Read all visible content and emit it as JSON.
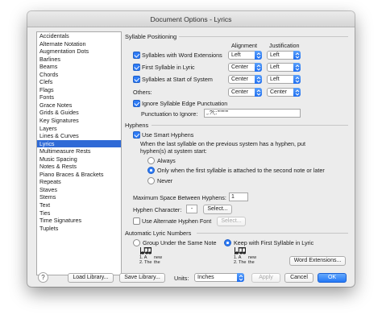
{
  "window": {
    "title": "Document Options - Lyrics"
  },
  "sidebar": {
    "items": [
      "Accidentals",
      "Alternate Notation",
      "Augmentation Dots",
      "Barlines",
      "Beams",
      "Chords",
      "Clefs",
      "Flags",
      "Fonts",
      "Grace Notes",
      "Grids & Guides",
      "Key Signatures",
      "Layers",
      "Lines & Curves",
      "Lyrics",
      "Multimeasure Rests",
      "Music Spacing",
      "Notes & Rests",
      "Piano Braces & Brackets",
      "Repeats",
      "Staves",
      "Stems",
      "Text",
      "Ties",
      "Time Signatures",
      "Tuplets"
    ],
    "selected": "Lyrics"
  },
  "syllable": {
    "heading": "Syllable Positioning",
    "col_alignment": "Alignment",
    "col_justification": "Justification",
    "rows": [
      {
        "label": "Syllables with Word Extensions",
        "checked": true,
        "alignment": "Left",
        "justification": "Left"
      },
      {
        "label": "First Syllable in Lyric",
        "checked": true,
        "alignment": "Center",
        "justification": "Left"
      },
      {
        "label": "Syllables at Start of System",
        "checked": true,
        "alignment": "Center",
        "justification": "Left"
      }
    ],
    "others_label": "Others:",
    "others_alignment": "Center",
    "others_justification": "Center",
    "ignore_label": "Ignore Syllable Edge Punctuation",
    "ignore_checked": true,
    "punct_label": "Punctuation to Ignore:",
    "punct_value": ",.?!;:'\"\"\"\"\""
  },
  "hyphens": {
    "heading": "Hyphens",
    "smart_label": "Use Smart Hyphens",
    "smart_checked": true,
    "desc1": "When the last syllable on the previous system has a hyphen, put",
    "desc2": "hyphen(s) at system start:",
    "opt_always": "Always",
    "opt_only": "Only when the first syllable is attached to the second note or later",
    "opt_never": "Never",
    "selected_option": "only",
    "max_label": "Maximum Space Between Hyphens:",
    "max_value": "1",
    "char_label": "Hyphen Character:",
    "char_value": "-",
    "select_label": "Select...",
    "alt_font_label": "Use Alternate Hyphen Font",
    "alt_font_checked": false,
    "alt_select_label": "Select..."
  },
  "auto_numbers": {
    "heading": "Automatic Lyric Numbers",
    "opt_group": "Group Under the Same Note",
    "opt_keep": "Keep with First Syllable in Lyric",
    "selected": "keep",
    "sample1_line1": "1. A",
    "sample1_line2": "2. The",
    "sample1_w1": "new",
    "sample1_w2": "the",
    "sample2_line1": "1. A",
    "sample2_line2": "2. The",
    "sample2_w1": "new",
    "sample2_w2": "the",
    "word_ext_button": "Word Extensions..."
  },
  "footer": {
    "help": "?",
    "load": "Load Library...",
    "save": "Save Library...",
    "units_label": "Units:",
    "units_value": "Inches",
    "apply": "Apply",
    "cancel": "Cancel",
    "ok": "OK"
  },
  "colors": {
    "accent": "#2f7cf6",
    "selection": "#2f6ad6"
  }
}
